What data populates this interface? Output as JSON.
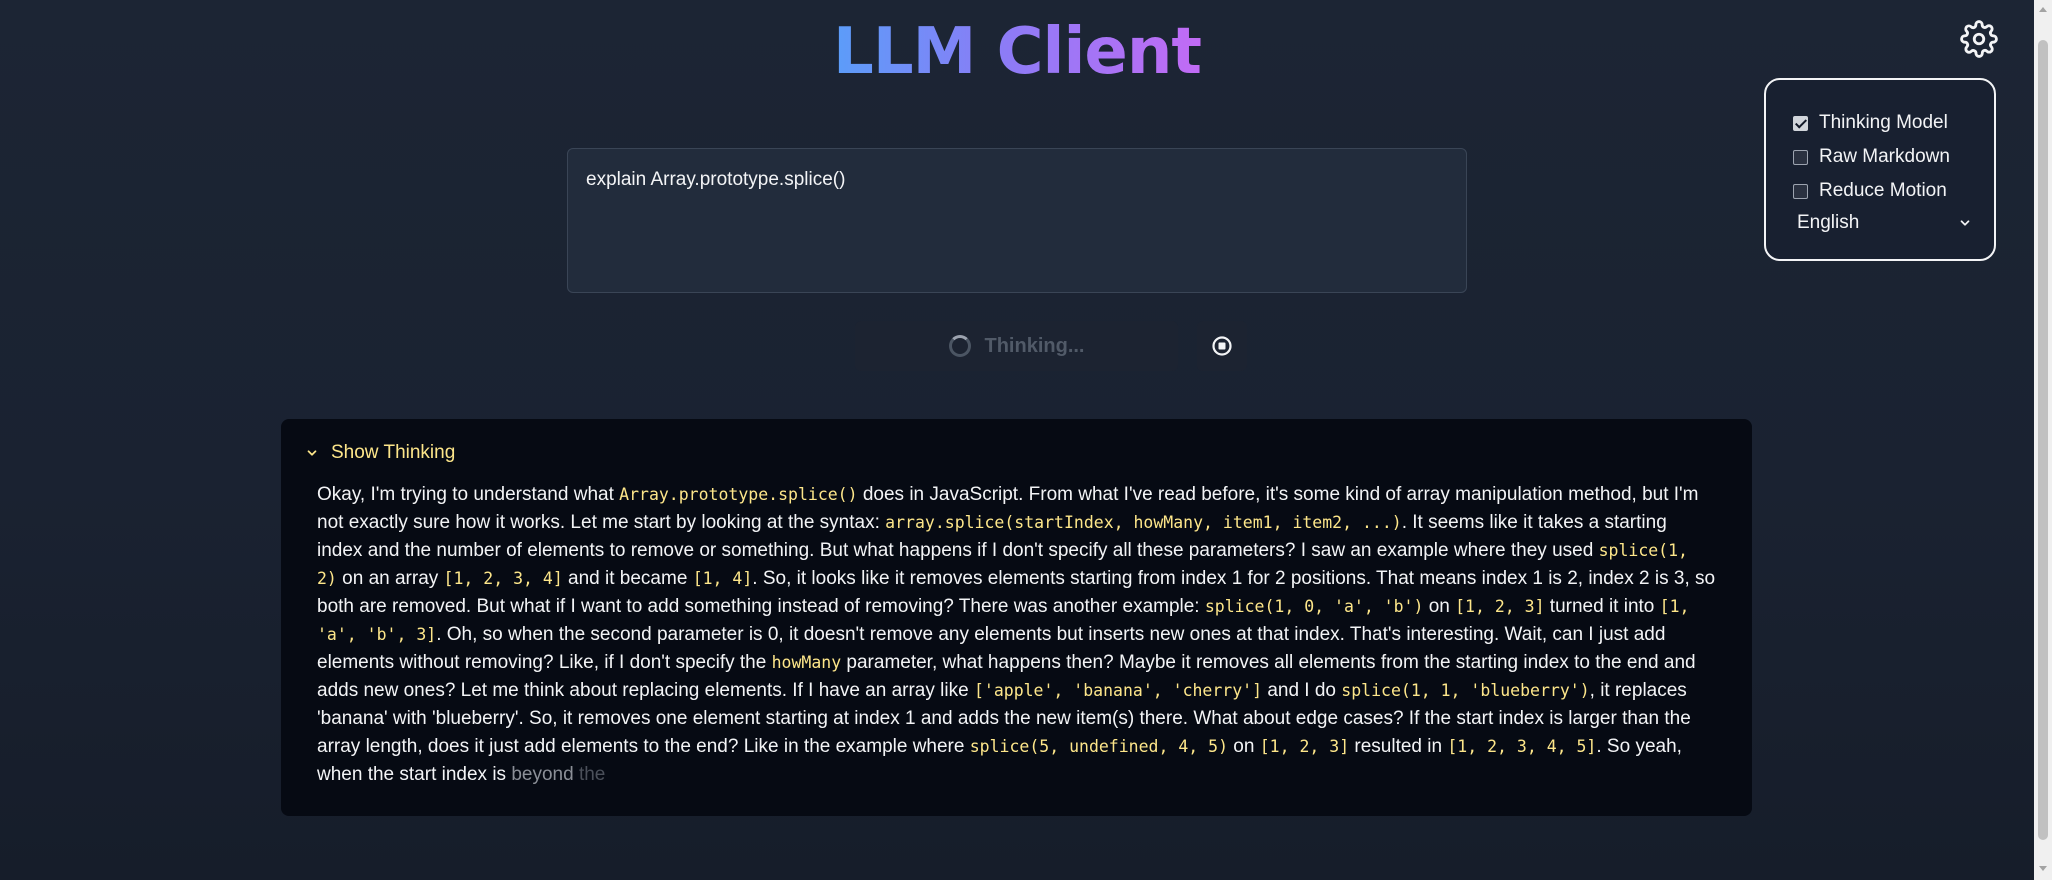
{
  "app": {
    "title": "LLM Client"
  },
  "settings": {
    "gear_icon": "gear-icon",
    "thinking_model": {
      "label": "Thinking Model",
      "checked": true
    },
    "raw_markdown": {
      "label": "Raw Markdown",
      "checked": false
    },
    "reduce_motion": {
      "label": "Reduce Motion",
      "checked": false
    },
    "language": {
      "selected": "English"
    }
  },
  "prompt": {
    "value": "explain Array.prototype.splice()"
  },
  "actions": {
    "submit_label": "Thinking...",
    "status": "loading",
    "stop_icon": "stop-icon"
  },
  "thinking": {
    "toggle_label": "Show Thinking",
    "segments": [
      {
        "t": "Okay, I'm trying to understand what "
      },
      {
        "c": "Array.prototype.splice()"
      },
      {
        "t": " does in JavaScript. From what I've read before, it's some kind of array manipulation method, but I'm not exactly sure how it works. Let me start by looking at the syntax: "
      },
      {
        "c": "array.splice(startIndex, howMany, item1, item2, ...)"
      },
      {
        "t": ". It seems like it takes a starting index and the number of elements to remove or something. But what happens if I don't specify all these parameters? I saw an example where they used "
      },
      {
        "c": "splice(1, 2)"
      },
      {
        "t": " on an array "
      },
      {
        "c": "[1, 2, 3, 4]"
      },
      {
        "t": " and it became "
      },
      {
        "c": "[1, 4]"
      },
      {
        "t": ". So, it looks like it removes elements starting from index 1 for 2 positions. That means index 1 is 2, index 2 is 3, so both are removed. But what if I want to add something instead of removing? There was another example: "
      },
      {
        "c": "splice(1, 0, 'a', 'b')"
      },
      {
        "t": " on "
      },
      {
        "c": "[1, 2, 3]"
      },
      {
        "t": " turned it into "
      },
      {
        "c": "[1, 'a', 'b', 3]"
      },
      {
        "t": ". Oh, so when the second parameter is 0, it doesn't remove any elements but inserts new ones at that index. That's interesting. Wait, can I just add elements without removing? Like, if I don't specify the "
      },
      {
        "c": "howMany"
      },
      {
        "t": " parameter, what happens then? Maybe it removes all elements from the starting index to the end and adds new ones? Let me think about replacing elements. If I have an array like "
      },
      {
        "c": "['apple', 'banana', 'cherry']"
      },
      {
        "t": " and I do "
      },
      {
        "c": "splice(1, 1, 'blueberry')"
      },
      {
        "t": ", it replaces 'banana' with 'blueberry'. So, it removes one element starting at index 1 and adds the new item(s) there. What about edge cases? If the start index is larger than the array length, does it just add elements to the end? Like in the example where "
      },
      {
        "c": "splice(5, undefined, 4, 5)"
      },
      {
        "t": " on "
      },
      {
        "c": "[1, 2, 3]"
      },
      {
        "t": " resulted in "
      },
      {
        "c": "[1, 2, 3, 4, 5]"
      },
      {
        "t": ". So yeah, when the start index is "
      },
      {
        "f1": "beyond"
      },
      {
        "t": " "
      },
      {
        "f2": "the"
      }
    ]
  }
}
